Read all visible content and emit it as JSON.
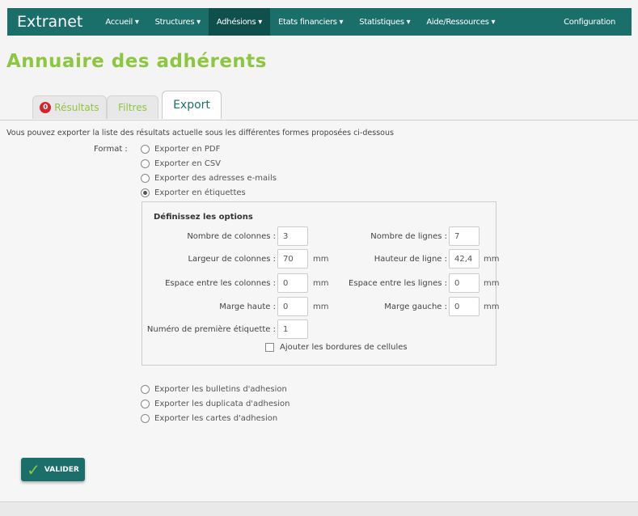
{
  "app": {
    "brand": "Extranet"
  },
  "nav": {
    "items": [
      {
        "label": "Accueil ▾"
      },
      {
        "label": "Structures ▾"
      },
      {
        "label": "Adhésions ▾"
      },
      {
        "label": "Etats financiers ▾"
      },
      {
        "label": "Statistiques ▾"
      },
      {
        "label": "Aide/Ressources ▾"
      }
    ],
    "config_label": "Configuration"
  },
  "page": {
    "title": "Annuaire des adhérents"
  },
  "tabs": {
    "results_badge": "0",
    "results_label": "Résultats",
    "filters_label": "Filtres",
    "export_label": "Export"
  },
  "export": {
    "intro": "Vous pouvez exporter la liste des résultats actuelle sous les différentes formes proposées ci-dessous",
    "format_label": "Format :",
    "formats": [
      "Exporter en PDF",
      "Exporter en CSV",
      "Exporter des adresses e-mails",
      "Exporter en étiquettes"
    ],
    "other_formats": [
      "Exporter les bulletins d'adhesion",
      "Exporter les duplicata d'adhesion",
      "Exporter les cartes d'adhesion"
    ]
  },
  "options": {
    "title": "Définissez les options",
    "nb_columns_label": "Nombre de colonnes :",
    "nb_columns": "3",
    "nb_rows_label": "Nombre de lignes :",
    "nb_rows": "7",
    "col_width_label": "Largeur de colonnes :",
    "col_width": "70",
    "row_height_label": "Hauteur de ligne :",
    "row_height": "42,4",
    "col_space_label": "Espace entre les colonnes :",
    "col_space": "0",
    "row_space_label": "Espace entre les lignes :",
    "row_space": "0",
    "top_margin_label": "Marge haute :",
    "top_margin": "0",
    "left_margin_label": "Marge gauche :",
    "left_margin": "0",
    "first_label_label": "Numéro de première étiquette :",
    "first_label": "1",
    "unit": "mm",
    "borders_label": "Ajouter les bordures de cellules"
  },
  "actions": {
    "submit_label": "VALIDER"
  }
}
